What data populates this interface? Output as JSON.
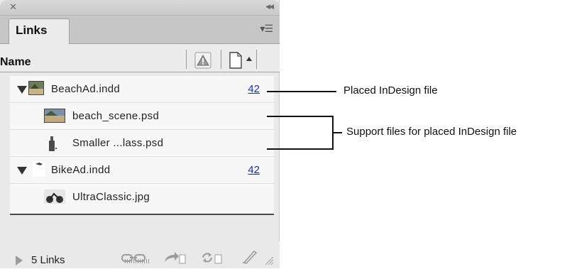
{
  "panel": {
    "title": "Links",
    "columns": {
      "name": "Name"
    },
    "items": [
      {
        "label": "BeachAd.indd",
        "count": "42",
        "level": 0,
        "expanded": true
      },
      {
        "label": "beach_scene.psd",
        "level": 1
      },
      {
        "label": "Smaller ...lass.psd",
        "level": 1
      },
      {
        "label": "BikeAd.indd",
        "count": "42",
        "level": 0,
        "expanded": true
      },
      {
        "label": "UltraClassic.jpg",
        "level": 1
      }
    ],
    "footer": {
      "links_count": "5 Links"
    }
  },
  "callouts": {
    "placed": "Placed InDesign file",
    "support": "Support files for placed InDesign file"
  },
  "colors": {
    "link_number": "#1a2fb8",
    "panel_bg": "#e9e9e9"
  }
}
